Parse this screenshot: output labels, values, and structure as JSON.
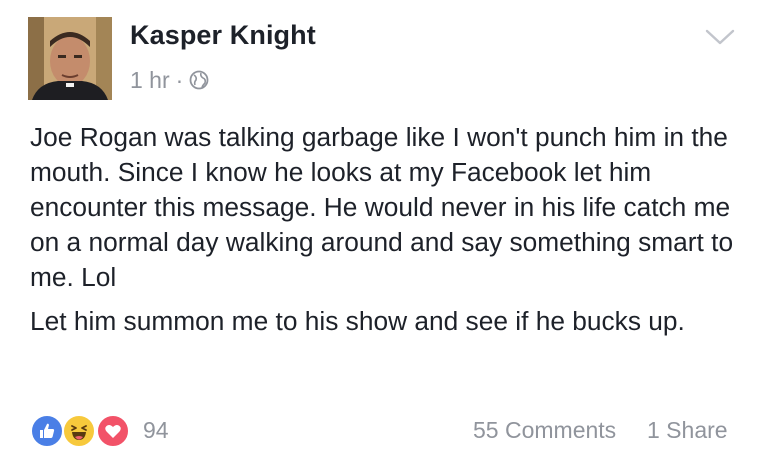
{
  "post": {
    "author": "Kasper Knight",
    "time": "1 hr",
    "separator": "·",
    "privacy_icon": "globe-icon",
    "menu_icon": "chevron-down-icon",
    "paragraphs": [
      "Joe Rogan was talking garbage like I won't punch him in the mouth. Since I know he looks at my Facebook let him encounter this message. He would never in his life catch me on a normal day walking around and say something smart to me. Lol",
      "Let him summon me to his show and see if he bucks up."
    ]
  },
  "footer": {
    "reaction_icons": [
      "like-icon",
      "haha-icon",
      "love-icon"
    ],
    "reaction_count": "94",
    "comments": "55 Comments",
    "shares": "1 Share"
  },
  "colors": {
    "text": "#1d2129",
    "secondary": "#90949c",
    "like": "#4a7fe6",
    "haha": "#f7c93c",
    "love": "#f25268"
  }
}
